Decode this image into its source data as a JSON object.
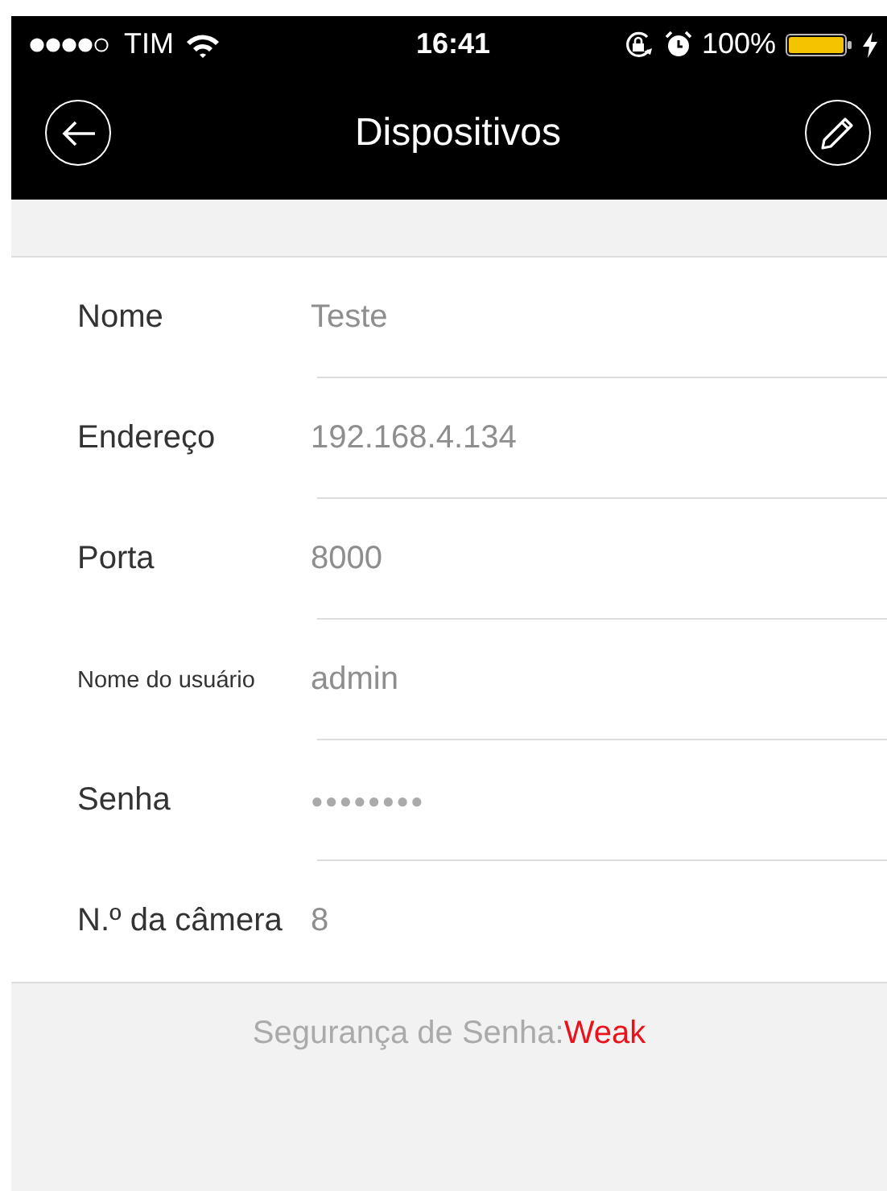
{
  "status_bar": {
    "carrier": "TIM",
    "time": "16:41",
    "battery": "100%"
  },
  "nav_bar": {
    "title": "Dispositivos"
  },
  "fields": [
    {
      "label": "Nome",
      "kind": "text",
      "value": "Teste",
      "compact_label": false
    },
    {
      "label": "Endereço",
      "kind": "text",
      "value": "192.168.4.134",
      "compact_label": false
    },
    {
      "label": "Porta",
      "kind": "text",
      "value": "8000",
      "compact_label": false
    },
    {
      "label": "Nome do usuário",
      "kind": "text",
      "value": "admin",
      "compact_label": true
    },
    {
      "label": "Senha",
      "kind": "password",
      "value": "●●●●●●●●",
      "compact_label": false
    },
    {
      "label": "N.º da câmera",
      "kind": "text",
      "value": "8",
      "compact_label": false
    }
  ],
  "password_strength": {
    "label": "Segurança de Senha:",
    "value": "Weak",
    "kind": "weak"
  }
}
